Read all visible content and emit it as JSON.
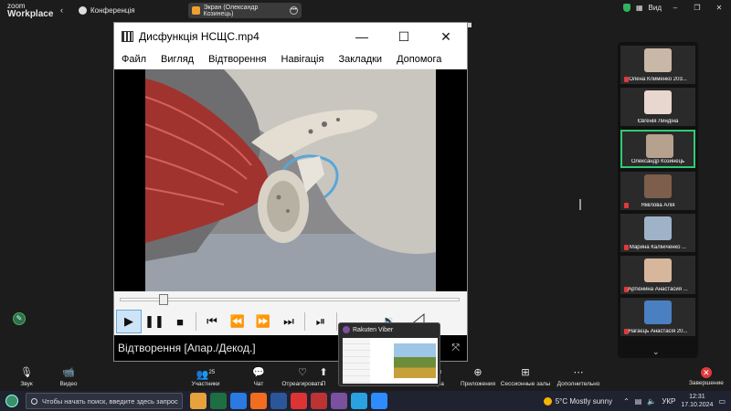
{
  "zoom": {
    "logo_line1": "zoom",
    "logo_line2": "Workplace",
    "conference_label": "Конференція",
    "share_label": "Экран (Олександр Козинець)",
    "view_label": "Вид"
  },
  "player": {
    "title": "Дисфункція НСЩС.mp4",
    "menu": [
      "Файл",
      "Вигляд",
      "Відтворення",
      "Навігація",
      "Закладки",
      "Допомога"
    ],
    "status": "Відтворення [Апар./Декод.]",
    "seek_fraction": 0.13
  },
  "viber": {
    "title": "Rakuten Viber"
  },
  "participants": [
    {
      "name": "Олена Клименко 203...",
      "face": "#c9b8a8",
      "muted": true
    },
    {
      "name": "Євгенія Линдіна",
      "face": "#e8d7cf",
      "muted": false
    },
    {
      "name": "Олександр Козинець",
      "face": "#b6a08e",
      "muted": false,
      "selected": true
    },
    {
      "name": "Ямілова Алія",
      "face": "#7d5d4c",
      "muted": true
    },
    {
      "name": "Марина Калініченко ...",
      "face": "#9fb3c8",
      "muted": true
    },
    {
      "name": "Артюнина Анастасия ...",
      "face": "#d7b79c",
      "muted": true
    },
    {
      "name": "Нагаєць Анастасія 20...",
      "face": "#4a7fc1",
      "muted": true
    }
  ],
  "toolbar": {
    "audio": "Звук",
    "video": "Видео",
    "participants": "Участники",
    "participants_count": "25",
    "chat": "Чат",
    "react": "Отреагировать",
    "share_partial": "П",
    "organizer_partial": "тора",
    "apps": "Приложения",
    "breakout": "Сессионные залы",
    "more": "Дополнительно",
    "end": "Завершение"
  },
  "taskbar": {
    "search_placeholder": "Чтобы начать поиск, введите здесь запрос",
    "weather": "5°C  Mostly sunny",
    "lang": "УКР",
    "time": "12:31",
    "date": "17.10.2024"
  },
  "colors": {
    "accent_green": "#2ecc71",
    "end_red": "#e03a3a",
    "viber_purple": "#7b519d"
  }
}
